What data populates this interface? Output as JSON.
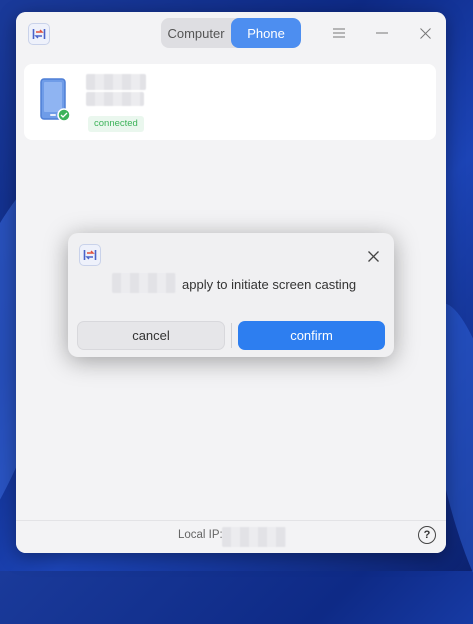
{
  "window": {
    "app_icon": "app-swap-icon",
    "tabs": [
      {
        "label": "Computer",
        "active": false
      },
      {
        "label": "Phone",
        "active": true
      }
    ],
    "controls": {
      "menu": "menu-icon",
      "minimize": "minimize-icon",
      "close": "close-icon"
    }
  },
  "device": {
    "icon": "phone-icon",
    "status": "connected",
    "status_color": "#3db35a"
  },
  "footer": {
    "local_ip_label": "Local IP:",
    "help_glyph": "?"
  },
  "dialog": {
    "icon": "app-swap-icon",
    "message": "apply to initiate screen casting",
    "cancel_label": "cancel",
    "confirm_label": "confirm",
    "accent": "#2d7ef0"
  }
}
